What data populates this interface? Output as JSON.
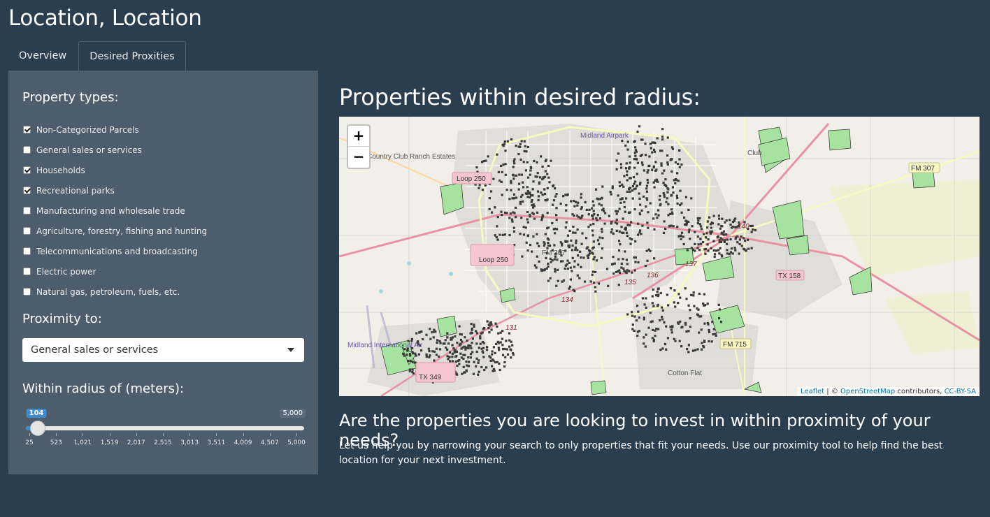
{
  "app": {
    "title": "Location, Location"
  },
  "tabs": [
    {
      "label": "Overview",
      "active": false
    },
    {
      "label": "Desired Proxities",
      "active": true
    }
  ],
  "sidebar": {
    "property_types_label": "Property types:",
    "property_types": [
      {
        "label": "Non-Categorized Parcels",
        "checked": true
      },
      {
        "label": "General sales or services",
        "checked": false
      },
      {
        "label": "Households",
        "checked": true
      },
      {
        "label": "Recreational parks",
        "checked": true
      },
      {
        "label": "Manufacturing and wholesale trade",
        "checked": false
      },
      {
        "label": "Agriculture, forestry, fishing and hunting",
        "checked": false
      },
      {
        "label": "Telecommunications and broadcasting",
        "checked": false
      },
      {
        "label": "Electric power",
        "checked": false
      },
      {
        "label": "Natural gas, petroleum, fuels, etc.",
        "checked": false
      }
    ],
    "proximity_label": "Proximity to:",
    "proximity_selected": "General sales or services",
    "radius_label": "Within radius of (meters):",
    "slider": {
      "min": 25,
      "max": 5000,
      "value": 104,
      "value_label": "104",
      "max_label": "5,000",
      "ticks": [
        "25",
        "523",
        "1,021",
        "1,519",
        "2,017",
        "2,515",
        "3,013",
        "3,511",
        "4,009",
        "4,507",
        "5,000"
      ]
    }
  },
  "main": {
    "heading": "Properties within desired radius:",
    "subheading": "Are the properties you are looking to invest in within proximity of your needs?",
    "body": "Let us help you by narrowing your search to only properties that fit your needs. Use our proximity tool to help find the best location for your next investment."
  },
  "map": {
    "zoom_in": "+",
    "zoom_out": "−",
    "labels": [
      "Midland Airpark",
      "Country Club Ranch Estates",
      "Loop 250",
      "TX 158",
      "FM 307",
      "140",
      "137",
      "135",
      "136",
      "134",
      "131",
      "TX 158",
      "FM 715",
      "Midland International Air",
      "Cotton Flat",
      "TX 349",
      "Club"
    ],
    "attribution": {
      "leaflet": "Leaflet",
      "sep": " | © ",
      "osm": "OpenStreetMap",
      "contrib": " contributors, ",
      "license": "CC-BY-SA"
    }
  }
}
